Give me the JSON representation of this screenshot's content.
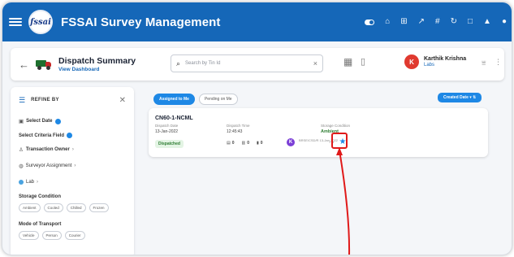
{
  "topbar": {
    "title": "FSSAI Survey Management",
    "logo_text": "fssai",
    "icons": [
      "toggle-icon",
      "home-icon",
      "grid-icon",
      "chart-icon",
      "hash-icon",
      "refresh-icon",
      "window-icon",
      "bell-icon",
      "user-icon"
    ],
    "color": "#1567b8"
  },
  "header": {
    "title": "Dispatch Summary",
    "subtitle": "View Dashboard",
    "search_placeholder": "Search by Tin Id",
    "user_initial": "K",
    "user_name": "Karthik Krishna",
    "user_role": "Labs"
  },
  "sidebar": {
    "title": "REFINE BY",
    "select_date": "Select Date",
    "select_criteria": "Select Criteria Field",
    "transaction_owner": "Transaction Owner",
    "surveyor_assignment": "Surveyor Assignment",
    "lab": "Lab",
    "storage_condition": "Storage Condition",
    "storage_chips": [
      "Ambient",
      "Cooled",
      "Chilled",
      "Frozen"
    ],
    "transport_mode": "Mode of Transport",
    "transport_chips": [
      "Vehicle",
      "Person",
      "Courier"
    ]
  },
  "main": {
    "tabs": [
      "Assigned to Me",
      "Pending on Me"
    ],
    "sort_label": "Created Date",
    "card": {
      "id": "CN60-1-NCML",
      "dispatch_date_label": "Dispatch Date",
      "dispatch_date": "13-Jan-2022",
      "dispatch_time_label": "Dispatch Time",
      "dispatch_time": "12:45:43",
      "storage_label": "Storage Condition",
      "storage_value": "Ambient",
      "status": "Dispatched",
      "counts": [
        "0",
        "0",
        "0"
      ],
      "signer_initial": "K",
      "signer_meta": "BRSE/CSD/R 13-Jan-2022"
    }
  },
  "accent": "#1e88e5",
  "annotation_color": "#e01a1a"
}
